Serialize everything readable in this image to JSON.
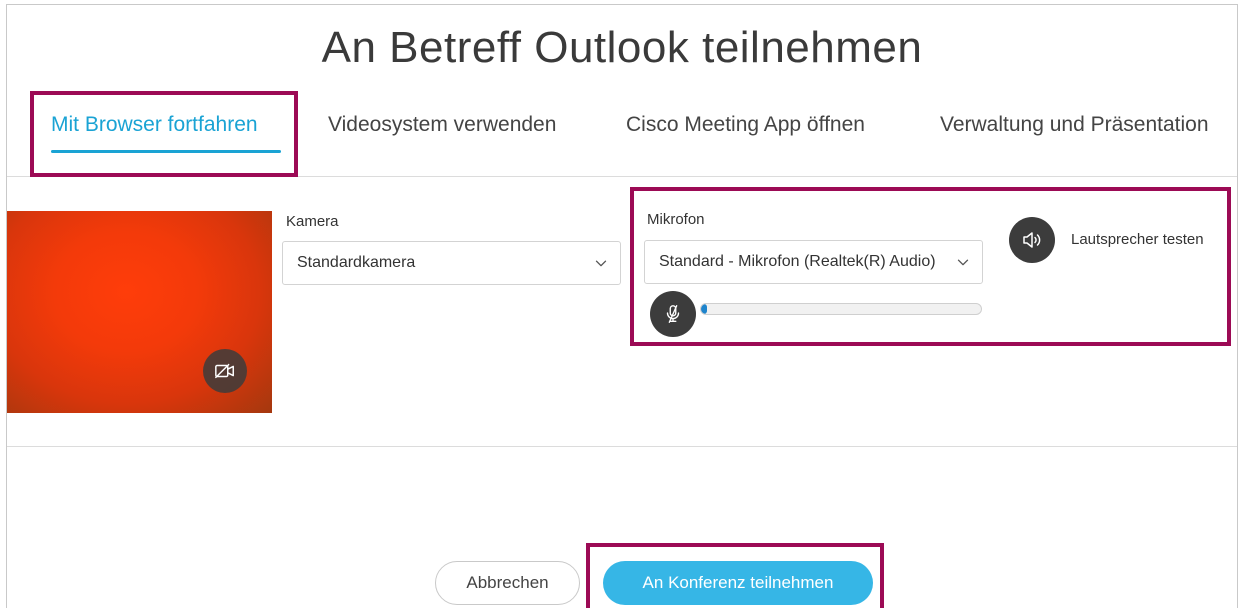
{
  "page": {
    "title": "An Betreff Outlook teilnehmen"
  },
  "tabs": [
    {
      "label": "Mit Browser fortfahren",
      "active": true
    },
    {
      "label": "Videosystem verwenden",
      "active": false
    },
    {
      "label": "Cisco Meeting App öffnen",
      "active": false
    },
    {
      "label": "Verwaltung und Präsentation",
      "active": false
    }
  ],
  "camera": {
    "label": "Kamera",
    "selected": "Standardkamera",
    "toggle_icon": "camera-off-icon"
  },
  "microphone": {
    "label": "Mikrofon",
    "selected": "Standard - Mikrofon (Realtek(R) Audio)",
    "mute_icon": "microphone-muted-icon",
    "level_fraction": 0.02
  },
  "speaker": {
    "label": "Lautsprecher testen",
    "icon": "speaker-icon"
  },
  "actions": {
    "cancel_label": "Abbrechen",
    "join_label": "An Konferenz teilnehmen"
  },
  "colors": {
    "accent": "#1aa3d4",
    "primary_button": "#36b6e6",
    "highlight_frame": "#9c0a55",
    "level_fill": "#1f84cc"
  }
}
